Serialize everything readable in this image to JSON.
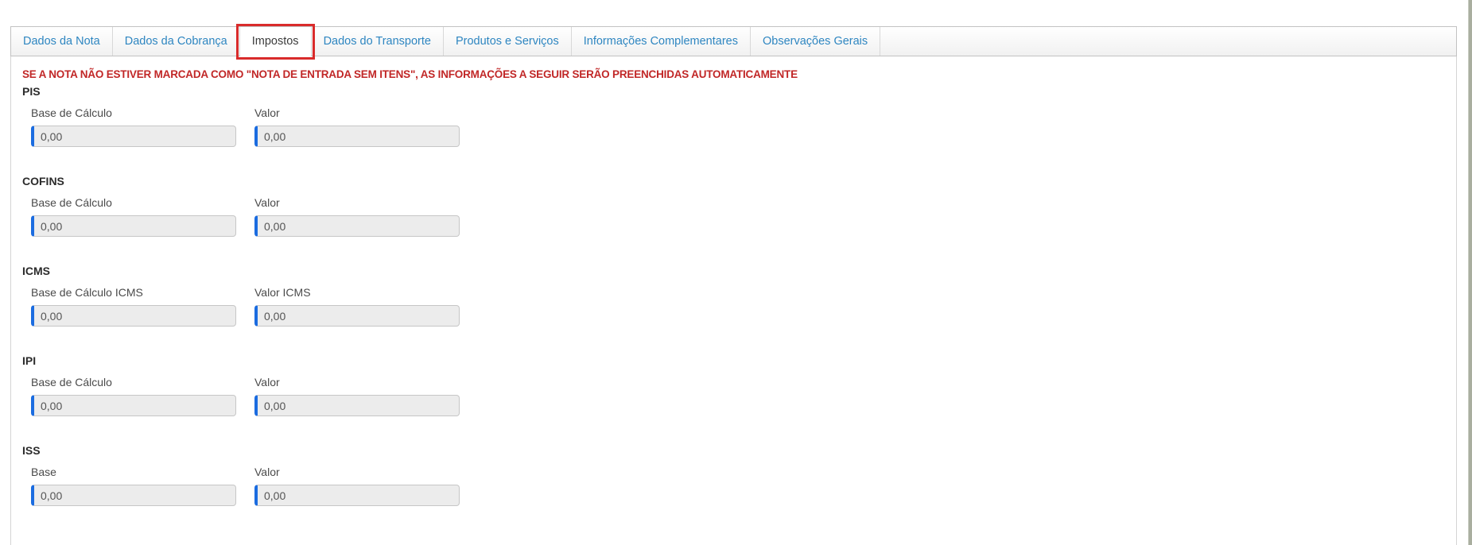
{
  "tabbar": {
    "active_tab": "Impostos",
    "tabs": [
      {
        "id": "dados-da-nota",
        "label": "Dados da Nota"
      },
      {
        "id": "dados-da-cobranca",
        "label": "Dados da Cobrança"
      },
      {
        "id": "impostos",
        "label": "Impostos"
      },
      {
        "id": "dados-do-transporte",
        "label": "Dados do Transporte"
      },
      {
        "id": "produtos-e-servicos",
        "label": "Produtos e Serviços"
      },
      {
        "id": "informacoes-complementares",
        "label": "Informações Complementares"
      },
      {
        "id": "observacoes-gerais",
        "label": "Observações Gerais"
      }
    ],
    "annotation": "red-highlight-box-around-active-tab"
  },
  "warning": "SE A NOTA NÃO ESTIVER MARCADA COMO \"NOTA DE ENTRADA SEM ITENS\", AS INFORMAÇÕES A SEGUIR SERÃO PREENCHIDAS AUTOMATICAMENTE",
  "sections": [
    {
      "id": "pis",
      "title": "PIS",
      "fields": [
        {
          "key": "base",
          "label": "Base de Cálculo",
          "value": "0,00"
        },
        {
          "key": "valor",
          "label": "Valor",
          "value": "0,00"
        }
      ]
    },
    {
      "id": "cofins",
      "title": "COFINS",
      "fields": [
        {
          "key": "base",
          "label": "Base de Cálculo",
          "value": "0,00"
        },
        {
          "key": "valor",
          "label": "Valor",
          "value": "0,00"
        }
      ]
    },
    {
      "id": "icms",
      "title": "ICMS",
      "fields": [
        {
          "key": "base",
          "label": "Base de Cálculo ICMS",
          "value": "0,00"
        },
        {
          "key": "valor",
          "label": "Valor ICMS",
          "value": "0,00"
        }
      ]
    },
    {
      "id": "ipi",
      "title": "IPI",
      "fields": [
        {
          "key": "base",
          "label": "Base de Cálculo",
          "value": "0,00"
        },
        {
          "key": "valor",
          "label": "Valor",
          "value": "0,00"
        }
      ]
    },
    {
      "id": "iss",
      "title": "ISS",
      "fields": [
        {
          "key": "base",
          "label": "Base",
          "value": "0,00"
        },
        {
          "key": "valor",
          "label": "Valor",
          "value": "0,00"
        }
      ]
    }
  ],
  "colors": {
    "tab_text": "#2e86c1",
    "tab_active_text": "#3c3c3c",
    "warning_text": "#c12727",
    "annotation_box": "#d92b2b",
    "input_accent": "#1b6ce0",
    "input_background": "#ececec"
  }
}
